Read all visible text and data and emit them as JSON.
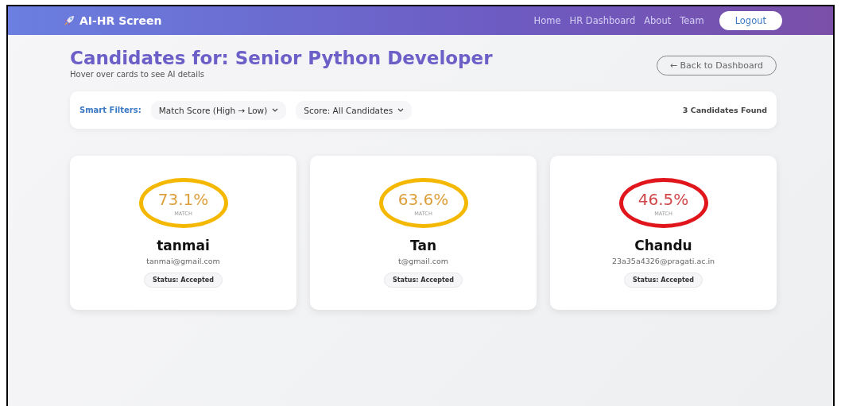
{
  "navbar": {
    "brand": "AI-HR Screen",
    "links": [
      "Home",
      "HR Dashboard",
      "About",
      "Team"
    ],
    "logout": "Logout"
  },
  "header": {
    "title": "Candidates for: Senior Python Developer",
    "subtitle": "Hover over cards to see AI details",
    "back": "← Back to Dashboard"
  },
  "filters": {
    "label": "Smart Filters:",
    "dropdowns": [
      "Match Score (High → Low)",
      "Score: All Candidates"
    ],
    "count": "3 Candidates Found"
  },
  "candidates": [
    {
      "score": "73.1%",
      "score_label": "MATCH",
      "color": "#f5b800",
      "name": "tanmai",
      "email": "tanmai@gmail.com",
      "status": "Status: Accepted"
    },
    {
      "score": "63.6%",
      "score_label": "MATCH",
      "color": "#f5b800",
      "name": "Tan",
      "email": "t@gmail.com",
      "status": "Status: Accepted"
    },
    {
      "score": "46.5%",
      "score_label": "MATCH",
      "color": "#e0161c",
      "name": "Chandu",
      "email": "23a35a4326@pragati.ac.in",
      "status": "Status: Accepted"
    }
  ]
}
